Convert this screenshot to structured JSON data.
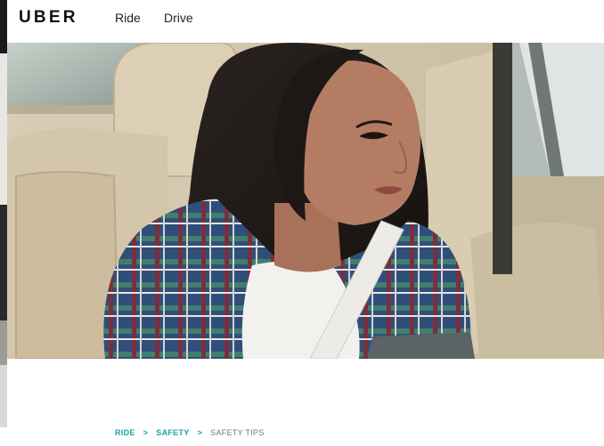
{
  "header": {
    "logo": "UBER",
    "nav": [
      {
        "label": "Ride"
      },
      {
        "label": "Drive"
      }
    ]
  },
  "hero": {
    "image_icon": "woman-in-backseat-photo"
  },
  "breadcrumb": {
    "items": [
      "RIDE",
      "SAFETY",
      "SAFETY TIPS"
    ],
    "separator": ">"
  },
  "colors": {
    "accent": "#1aa4a7",
    "text": "#111111",
    "muted": "#777777"
  }
}
